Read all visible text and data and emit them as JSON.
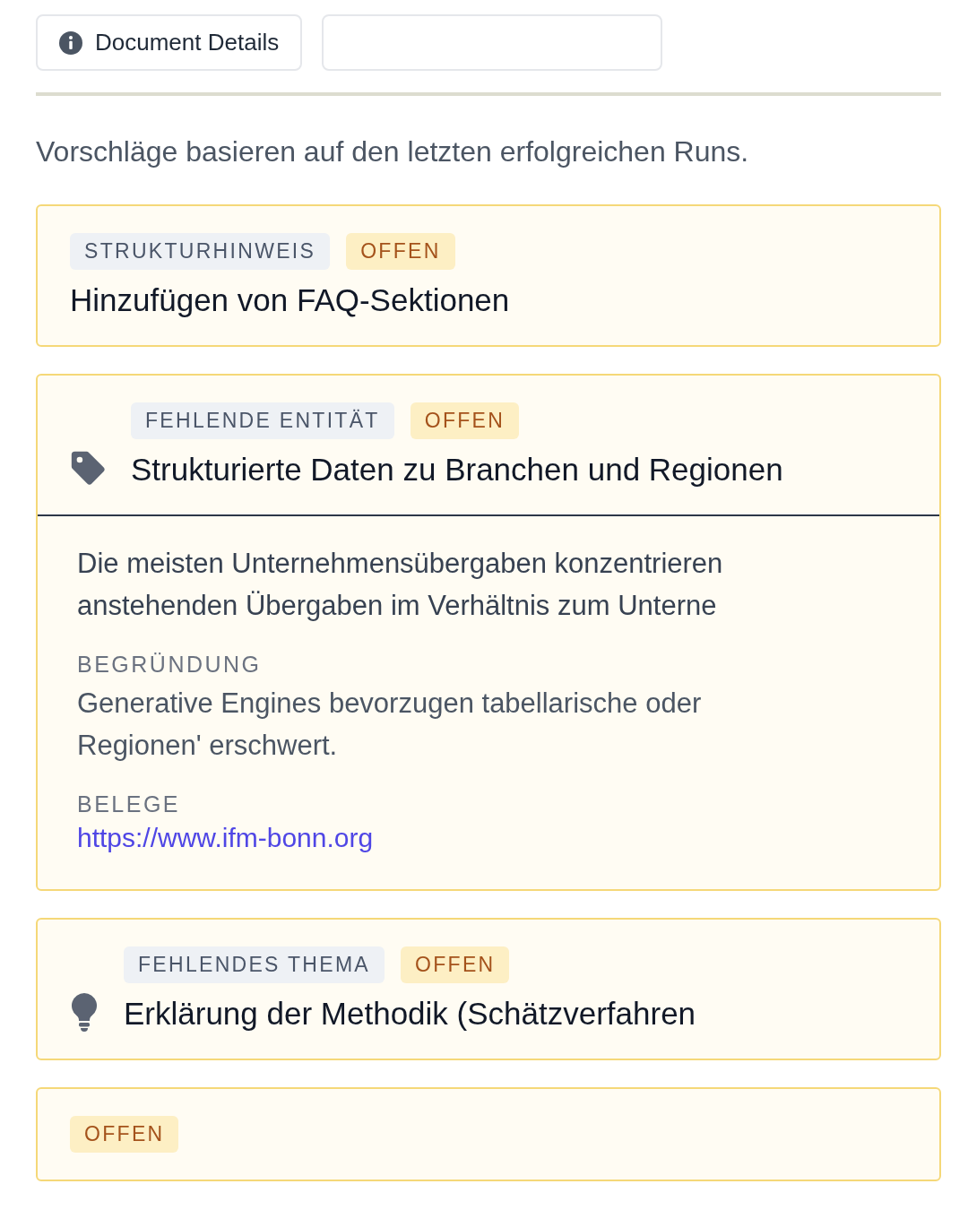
{
  "tabs": [
    {
      "kind": "labeled",
      "label": "Document Details"
    },
    {
      "kind": "blank"
    }
  ],
  "intro": "Vorschläge basieren auf den letzten erfolgreichen Runs.",
  "suggestions": [
    {
      "kind": "structure",
      "type_label": "STRUKTURHINWEIS",
      "status": "OFFEN",
      "title": "Hinzufügen von FAQ-Sektionen",
      "expanded": false
    },
    {
      "kind": "entity",
      "type_label": "FEHLENDE ENTITÄT",
      "status": "OFFEN",
      "title": "Strukturierte Daten zu Branchen und Regionen",
      "expanded": true,
      "details": {
        "description_lines": [
          "Die meisten Unternehmensübergaben konzentrieren",
          "anstehenden Übergaben im Verhältnis zum Unterne"
        ],
        "reasoning_label": "BEGRÜNDUNG",
        "reasoning_lines": [
          "Generative Engines bevorzugen tabellarische oder",
          "Regionen' erschwert."
        ],
        "evidence_label": "BELEGE",
        "evidence_link": "https://www.ifm-bonn.org"
      }
    },
    {
      "kind": "topic",
      "type_label": "FEHLENDES THEMA",
      "status": "OFFEN",
      "title": "Erklärung der Methodik (Schätzverfahren",
      "expanded": false
    },
    {
      "status": "OFFEN",
      "expanded": false
    }
  ]
}
